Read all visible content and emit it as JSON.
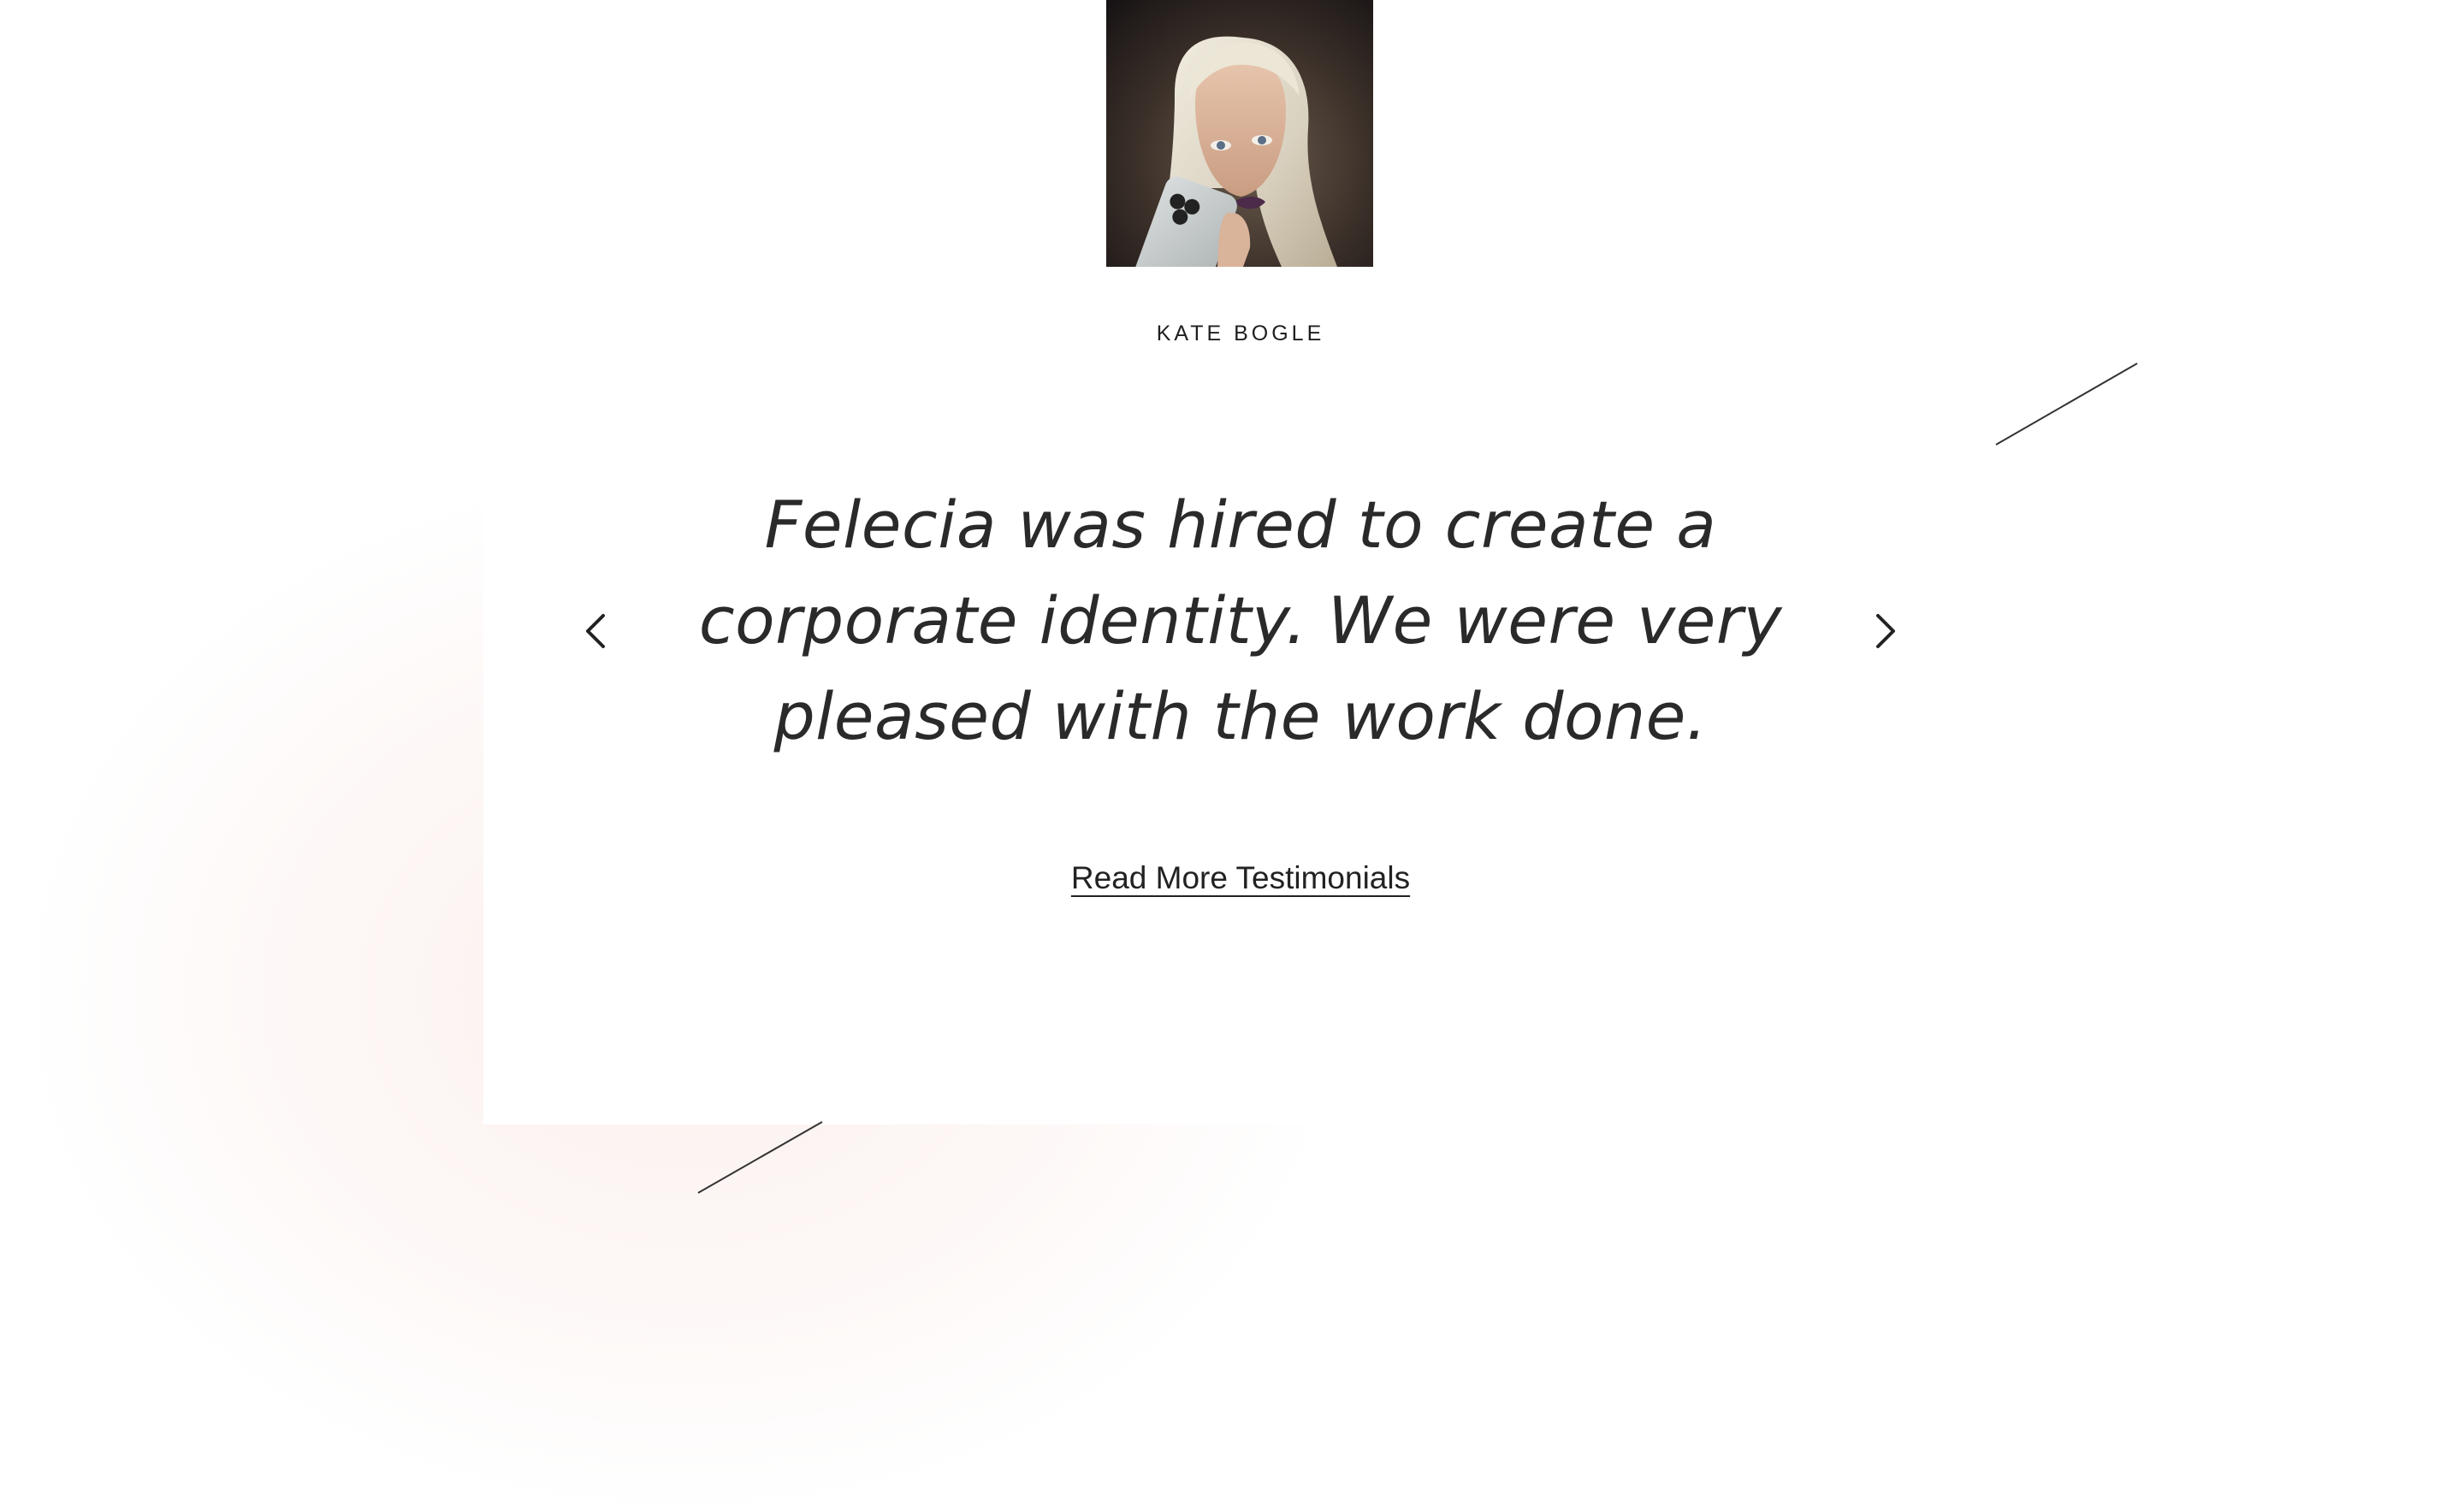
{
  "testimonial": {
    "author_name": "KATE BOGLE",
    "quote": "Felecia was hired to create a corporate identity. We were very pleased with the work done.",
    "read_more_label": "Read More Testimonials"
  },
  "controls": {
    "prev_icon": "chevron-left-icon",
    "next_icon": "chevron-right-icon"
  },
  "colors": {
    "text": "#2a2a2a",
    "background": "#ffffff",
    "blob": "#f8e4de"
  }
}
